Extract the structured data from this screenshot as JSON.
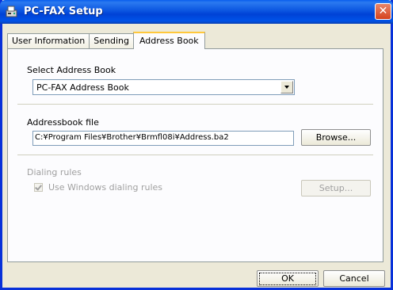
{
  "window": {
    "title": "PC-FAX Setup",
    "icon": "fax-icon",
    "close_icon": "close-icon"
  },
  "tabs": [
    {
      "label": "User Information",
      "active": false
    },
    {
      "label": "Sending",
      "active": false
    },
    {
      "label": "Address Book",
      "active": true
    }
  ],
  "address_book": {
    "select_label": "Select Address Book",
    "selected_value": "PC-FAX Address Book",
    "file_label": "Addressbook file",
    "file_path": "C:¥Program Files¥Brother¥Brmfl08i¥Address.ba2",
    "browse_label": "Browse..."
  },
  "dialing_rules": {
    "group_label": "Dialing rules",
    "checkbox_label": "Use Windows dialing rules",
    "checked": true,
    "enabled": false,
    "setup_label": "Setup..."
  },
  "footer": {
    "ok_label": "OK",
    "cancel_label": "Cancel"
  },
  "colors": {
    "titlebar": "#0053e8",
    "dialog_bg": "#ece9d8",
    "tab_highlight": "#ffc83c"
  }
}
